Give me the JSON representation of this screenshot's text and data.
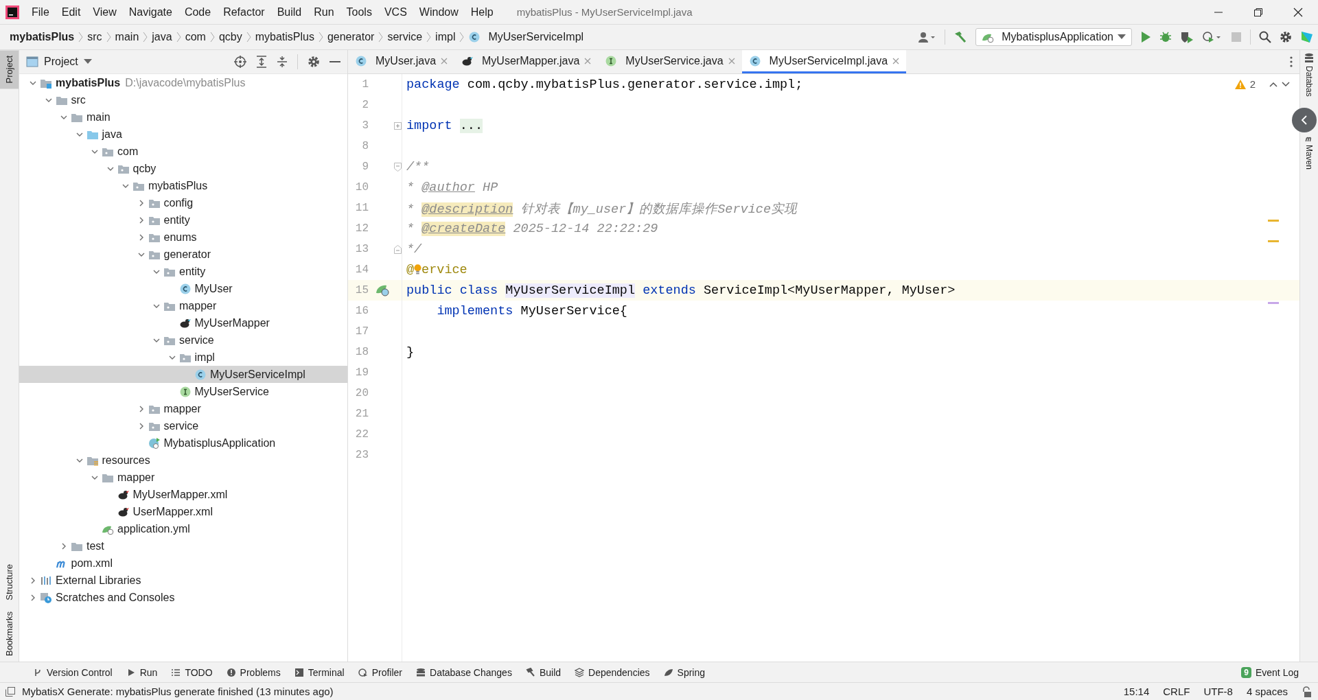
{
  "window": {
    "title": "mybatisPlus - MyUserServiceImpl.java"
  },
  "menu": [
    "File",
    "Edit",
    "View",
    "Navigate",
    "Code",
    "Refactor",
    "Build",
    "Run",
    "Tools",
    "VCS",
    "Window",
    "Help"
  ],
  "breadcrumb": [
    {
      "label": "mybatisPlus",
      "kind": "project"
    },
    {
      "label": "src",
      "kind": "dir"
    },
    {
      "label": "main",
      "kind": "dir"
    },
    {
      "label": "java",
      "kind": "dir"
    },
    {
      "label": "com",
      "kind": "dir"
    },
    {
      "label": "qcby",
      "kind": "dir"
    },
    {
      "label": "mybatisPlus",
      "kind": "dir"
    },
    {
      "label": "generator",
      "kind": "dir"
    },
    {
      "label": "service",
      "kind": "dir"
    },
    {
      "label": "impl",
      "kind": "dir"
    },
    {
      "label": "MyUserServiceImpl",
      "kind": "class"
    }
  ],
  "run_config": "MybatisplusApplication",
  "left_stripe": [
    {
      "label": "Project",
      "selected": true
    },
    {
      "label": "Structure",
      "selected": false
    },
    {
      "label": "Bookmarks",
      "selected": false
    }
  ],
  "right_stripe": [
    {
      "label": "Databas"
    },
    {
      "label": "Maven"
    }
  ],
  "project_panel": {
    "title": "Project",
    "tree": [
      {
        "label": "mybatisPlus",
        "kind": "module",
        "path": "D:\\javacode\\mybatisPlus",
        "expanded": true,
        "selected": false,
        "children": [
          {
            "label": "src",
            "kind": "folder",
            "expanded": true,
            "selected": false,
            "children": [
              {
                "label": "main",
                "kind": "folder",
                "expanded": true,
                "selected": false,
                "children": [
                  {
                    "label": "java",
                    "kind": "source",
                    "expanded": true,
                    "selected": false,
                    "children": [
                      {
                        "label": "com",
                        "kind": "package",
                        "expanded": true,
                        "selected": false,
                        "children": [
                          {
                            "label": "qcby",
                            "kind": "package",
                            "expanded": true,
                            "selected": false,
                            "children": [
                              {
                                "label": "mybatisPlus",
                                "kind": "package",
                                "expanded": true,
                                "selected": false,
                                "children": [
                                  {
                                    "label": "config",
                                    "kind": "package",
                                    "expanded": false,
                                    "selected": false
                                  },
                                  {
                                    "label": "entity",
                                    "kind": "package",
                                    "expanded": false,
                                    "selected": false
                                  },
                                  {
                                    "label": "enums",
                                    "kind": "package",
                                    "expanded": false,
                                    "selected": false
                                  },
                                  {
                                    "label": "generator",
                                    "kind": "package",
                                    "expanded": true,
                                    "selected": false,
                                    "children": [
                                      {
                                        "label": "entity",
                                        "kind": "package",
                                        "expanded": true,
                                        "selected": false,
                                        "children": [
                                          {
                                            "label": "MyUser",
                                            "kind": "class",
                                            "selected": false
                                          }
                                        ]
                                      },
                                      {
                                        "label": "mapper",
                                        "kind": "package",
                                        "expanded": true,
                                        "selected": false,
                                        "children": [
                                          {
                                            "label": "MyUserMapper",
                                            "kind": "mapper",
                                            "selected": false
                                          }
                                        ]
                                      },
                                      {
                                        "label": "service",
                                        "kind": "package",
                                        "expanded": true,
                                        "selected": false,
                                        "children": [
                                          {
                                            "label": "impl",
                                            "kind": "package",
                                            "expanded": true,
                                            "selected": false,
                                            "children": [
                                              {
                                                "label": "MyUserServiceImpl",
                                                "kind": "class",
                                                "selected": true
                                              }
                                            ]
                                          },
                                          {
                                            "label": "MyUserService",
                                            "kind": "interface",
                                            "selected": false
                                          }
                                        ]
                                      }
                                    ]
                                  },
                                  {
                                    "label": "mapper",
                                    "kind": "package",
                                    "expanded": false,
                                    "selected": false
                                  },
                                  {
                                    "label": "service",
                                    "kind": "package",
                                    "expanded": false,
                                    "selected": false
                                  },
                                  {
                                    "label": "MybatisplusApplication",
                                    "kind": "spring-app",
                                    "selected": false
                                  }
                                ]
                              }
                            ]
                          }
                        ]
                      }
                    ]
                  },
                  {
                    "label": "resources",
                    "kind": "resources",
                    "expanded": true,
                    "selected": false,
                    "children": [
                      {
                        "label": "mapper",
                        "kind": "folder",
                        "expanded": true,
                        "selected": false,
                        "children": [
                          {
                            "label": "MyUserMapper.xml",
                            "kind": "mapper-xml",
                            "selected": false
                          },
                          {
                            "label": "UserMapper.xml",
                            "kind": "mapper-xml",
                            "selected": false
                          }
                        ]
                      },
                      {
                        "label": "application.yml",
                        "kind": "yml",
                        "selected": false
                      }
                    ]
                  }
                ]
              },
              {
                "label": "test",
                "kind": "folder",
                "expanded": false,
                "selected": false
              }
            ]
          },
          {
            "label": "pom.xml",
            "kind": "maven",
            "selected": false
          }
        ]
      },
      {
        "label": "External Libraries",
        "kind": "libraries",
        "expanded": false,
        "selected": false
      },
      {
        "label": "Scratches and Consoles",
        "kind": "scratches",
        "expanded": false,
        "selected": false
      }
    ]
  },
  "tabs": [
    {
      "label": "MyUser.java",
      "kind": "class",
      "selected": false
    },
    {
      "label": "MyUserMapper.java",
      "kind": "mapper",
      "selected": false
    },
    {
      "label": "MyUserService.java",
      "kind": "interface",
      "selected": false
    },
    {
      "label": "MyUserServiceImpl.java",
      "kind": "class",
      "selected": true
    }
  ],
  "editor": {
    "warnings": "2",
    "lines": [
      {
        "number": "1",
        "tokens": [
          {
            "text": "package",
            "kind": "keyword"
          },
          {
            "text": " com.qcby.mybatisPlus.generator.service.impl;",
            "kind": "plain"
          }
        ]
      },
      {
        "number": "2"
      },
      {
        "number": "3",
        "gutter": {
          "kind": "fold-plus"
        },
        "tokens": [
          {
            "text": "import ",
            "kind": "keyword"
          },
          {
            "text": "...",
            "kind": "folded"
          }
        ]
      },
      {
        "number": "8"
      },
      {
        "number": "9",
        "gutter": {
          "kind": "fold-open"
        },
        "tokens": [
          {
            "text": "/**",
            "kind": "doc"
          }
        ]
      },
      {
        "number": "10",
        "tokens": [
          {
            "text": "* ",
            "kind": "doc"
          },
          {
            "text": "@author",
            "kind": "doc-tag"
          },
          {
            "text": " HP",
            "kind": "doc"
          }
        ]
      },
      {
        "number": "11",
        "tokens": [
          {
            "text": "* ",
            "kind": "doc"
          },
          {
            "text": "@description",
            "kind": "doc-tag-warn"
          },
          {
            "text": " 针对表【my_user】的数据库操作Service实现",
            "kind": "doc"
          }
        ]
      },
      {
        "number": "12",
        "tokens": [
          {
            "text": "* ",
            "kind": "doc"
          },
          {
            "text": "@createDate",
            "kind": "doc-tag-warn"
          },
          {
            "text": " 2025-12-14 22:22:29",
            "kind": "doc"
          }
        ]
      },
      {
        "number": "13",
        "gutter": {
          "kind": "fold-close"
        },
        "tokens": [
          {
            "text": "*/",
            "kind": "doc"
          }
        ]
      },
      {
        "number": "14",
        "tokens": [
          {
            "text": "@",
            "kind": "annotation"
          },
          {
            "kind": "bulb"
          },
          {
            "text": "ervice",
            "kind": "annotation"
          }
        ]
      },
      {
        "number": "15",
        "gutter": {
          "kind": "bean"
        },
        "current": true,
        "tokens": [
          {
            "text": "public class ",
            "kind": "keyword"
          },
          {
            "text": "MyUserServiceImpl",
            "kind": "highlight"
          },
          {
            "text": " extends",
            "kind": "keyword"
          },
          {
            "text": " ServiceImpl<MyUserMapper, MyUser>",
            "kind": "plain"
          }
        ]
      },
      {
        "number": "16",
        "tokens": [
          {
            "text": "    implements",
            "kind": "keyword"
          },
          {
            "text": " MyUserService{",
            "kind": "plain"
          }
        ]
      },
      {
        "number": "17"
      },
      {
        "number": "18",
        "tokens": [
          {
            "text": "}",
            "kind": "plain"
          }
        ]
      },
      {
        "number": "19"
      },
      {
        "number": "20"
      },
      {
        "number": "21"
      },
      {
        "number": "22"
      },
      {
        "number": "23"
      }
    ]
  },
  "tool_windows": [
    {
      "label": "Version Control",
      "kind": "vcs"
    },
    {
      "label": "Run",
      "kind": "run"
    },
    {
      "label": "TODO",
      "kind": "todo"
    },
    {
      "label": "Problems",
      "kind": "problems"
    },
    {
      "label": "Terminal",
      "kind": "terminal"
    },
    {
      "label": "Profiler",
      "kind": "profiler"
    },
    {
      "label": "Database Changes",
      "kind": "db"
    },
    {
      "label": "Build",
      "kind": "build"
    },
    {
      "label": "Dependencies",
      "kind": "deps"
    },
    {
      "label": "Spring",
      "kind": "spring"
    }
  ],
  "event_log": {
    "count": "9",
    "label": "Event Log"
  },
  "status_bar": {
    "message": "MybatisX Generate: mybatisPlus generate finished (13 minutes ago)",
    "position": "15:14",
    "line_separator": "CRLF",
    "encoding": "UTF-8",
    "indent": "4 spaces"
  }
}
